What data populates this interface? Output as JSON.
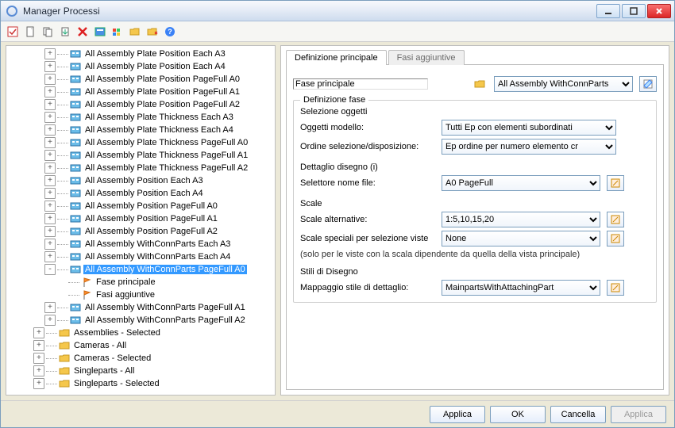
{
  "window": {
    "title": "Manager Processi"
  },
  "toolbar_icons": [
    "select",
    "new",
    "copy",
    "import",
    "delete",
    "tile",
    "color",
    "fold1",
    "fold2",
    "help"
  ],
  "tree": {
    "items": [
      {
        "label": "All Assembly Plate Position Each A3",
        "icon": "proc",
        "depth": 3,
        "exp": "+"
      },
      {
        "label": "All Assembly Plate Position Each A4",
        "icon": "proc",
        "depth": 3,
        "exp": "+"
      },
      {
        "label": "All Assembly Plate Position PageFull A0",
        "icon": "proc",
        "depth": 3,
        "exp": "+"
      },
      {
        "label": "All Assembly Plate Position PageFull A1",
        "icon": "proc",
        "depth": 3,
        "exp": "+"
      },
      {
        "label": "All Assembly Plate Position PageFull A2",
        "icon": "proc",
        "depth": 3,
        "exp": "+"
      },
      {
        "label": "All Assembly Plate Thickness Each A3",
        "icon": "proc",
        "depth": 3,
        "exp": "+"
      },
      {
        "label": "All Assembly Plate Thickness Each A4",
        "icon": "proc",
        "depth": 3,
        "exp": "+"
      },
      {
        "label": "All Assembly Plate Thickness PageFull A0",
        "icon": "proc",
        "depth": 3,
        "exp": "+"
      },
      {
        "label": "All Assembly Plate Thickness PageFull A1",
        "icon": "proc",
        "depth": 3,
        "exp": "+"
      },
      {
        "label": "All Assembly Plate Thickness PageFull A2",
        "icon": "proc",
        "depth": 3,
        "exp": "+"
      },
      {
        "label": "All Assembly Position Each A3",
        "icon": "proc",
        "depth": 3,
        "exp": "+"
      },
      {
        "label": "All Assembly Position Each A4",
        "icon": "proc",
        "depth": 3,
        "exp": "+"
      },
      {
        "label": "All Assembly Position PageFull A0",
        "icon": "proc",
        "depth": 3,
        "exp": "+"
      },
      {
        "label": "All Assembly Position PageFull A1",
        "icon": "proc",
        "depth": 3,
        "exp": "+"
      },
      {
        "label": "All Assembly Position PageFull A2",
        "icon": "proc",
        "depth": 3,
        "exp": "+"
      },
      {
        "label": "All Assembly WithConnParts Each A3",
        "icon": "proc",
        "depth": 3,
        "exp": "+"
      },
      {
        "label": "All Assembly WithConnParts Each A4",
        "icon": "proc",
        "depth": 3,
        "exp": "+"
      },
      {
        "label": "All Assembly WithConnParts PageFull A0",
        "icon": "proc",
        "depth": 3,
        "exp": "-",
        "selected": true
      },
      {
        "label": "Fase principale",
        "icon": "flag",
        "depth": 4,
        "exp": ""
      },
      {
        "label": "Fasi aggiuntive",
        "icon": "flag",
        "depth": 4,
        "exp": ""
      },
      {
        "label": "All Assembly WithConnParts PageFull A1",
        "icon": "proc",
        "depth": 3,
        "exp": "+"
      },
      {
        "label": "All Assembly WithConnParts PageFull A2",
        "icon": "proc",
        "depth": 3,
        "exp": "+"
      },
      {
        "label": "Assemblies - Selected",
        "icon": "folder",
        "depth": 2,
        "exp": "+"
      },
      {
        "label": "Cameras - All",
        "icon": "folder",
        "depth": 2,
        "exp": "+"
      },
      {
        "label": "Cameras - Selected",
        "icon": "folder",
        "depth": 2,
        "exp": "+"
      },
      {
        "label": "Singleparts - All",
        "icon": "folder",
        "depth": 2,
        "exp": "+"
      },
      {
        "label": "Singleparts - Selected",
        "icon": "folder",
        "depth": 2,
        "exp": "+"
      }
    ]
  },
  "tabs": {
    "main": "Definizione principale",
    "extra": "Fasi aggiuntive"
  },
  "main_step": {
    "label": "Fase principale",
    "value": "All Assembly WithConnParts",
    "icon": "folder"
  },
  "group_def": {
    "legend": "Definizione fase",
    "selezione_oggetti": "Selezione oggetti",
    "oggetti_modello_label": "Oggetti modello:",
    "oggetti_modello_value": "Tutti Ep con elementi subordinati",
    "ordine_label": "Ordine selezione/disposizione:",
    "ordine_value": "Ep ordine per numero elemento cr",
    "dettaglio_legend": "Dettaglio disegno (i)",
    "selettore_label": "Selettore nome file:",
    "selettore_value": "A0 PageFull",
    "scale_legend": "Scale",
    "scale_alt_label": "Scale alternative:",
    "scale_alt_value": "1:5,10,15,20",
    "scale_spec_label": "Scale speciali per selezione viste",
    "scale_spec_value": "None",
    "scale_note": "(solo per le viste con la scala dipendente da quella della vista principale)",
    "stili_legend": "Stili di Disegno",
    "mapping_label": "Mappaggio stile di dettaglio:",
    "mapping_value": "MainpartsWithAttachingPart"
  },
  "footer": {
    "apply": "Applica",
    "ok": "OK",
    "cancel": "Cancella",
    "apply2": "Applica"
  }
}
